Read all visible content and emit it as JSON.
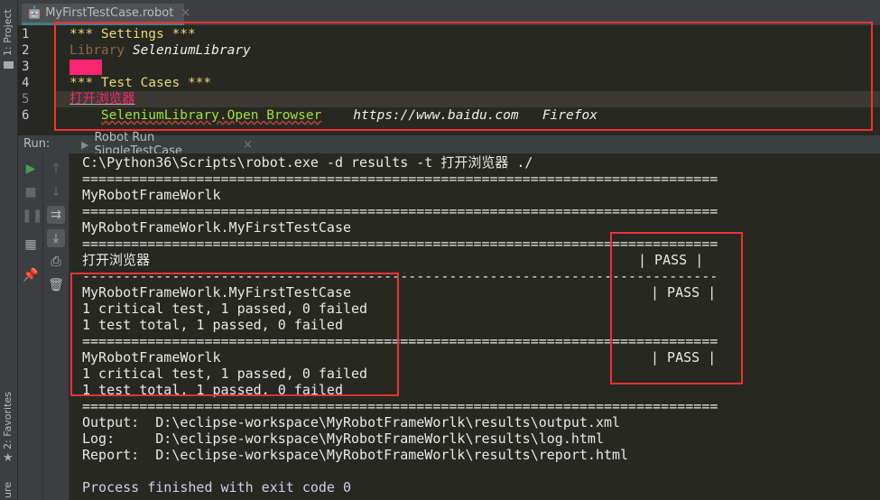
{
  "side": {
    "project": "1: Project",
    "favorites": "2: Favorites",
    "structure": "ure"
  },
  "editor_tab": {
    "label": "MyFirstTestCase.robot",
    "close": "×"
  },
  "editor": {
    "line_numbers": [
      "1",
      "2",
      "3",
      "4",
      "5",
      "6"
    ],
    "settings_header": "*** Settings ***",
    "library_kw": "Library",
    "library_name": "SeleniumLibrary",
    "testcases_header": "*** Test Cases ***",
    "test_name": "打开浏览器",
    "keyword": "SeleniumLibrary.Open Browser",
    "arg_url": "https://www.baidu.com",
    "arg_browser": "Firefox"
  },
  "run": {
    "label": "Run:",
    "tab": "Robot Run SingleTestCase",
    "close": "×"
  },
  "console": {
    "lines": [
      "C:\\Python36\\Scripts\\robot.exe -d results -t 打开浏览器 ./",
      "==============================================================================",
      "MyRobotFrameWorlk",
      "==============================================================================",
      "MyRobotFrameWorlk.MyFirstTestCase",
      "==============================================================================",
      "打开浏览器",
      "------------------------------------------------------------------------------",
      "MyRobotFrameWorlk.MyFirstTestCase",
      "1 critical test, 1 passed, 0 failed",
      "1 test total, 1 passed, 0 failed",
      "==============================================================================",
      "MyRobotFrameWorlk",
      "1 critical test, 1 passed, 0 failed",
      "1 test total, 1 passed, 0 failed",
      "==============================================================================",
      "Output:  D:\\eclipse-workspace\\MyRobotFrameWorlk\\results\\output.xml",
      "Log:     D:\\eclipse-workspace\\MyRobotFrameWorlk\\results\\log.html",
      "Report:  D:\\eclipse-workspace\\MyRobotFrameWorlk\\results\\report.html",
      "",
      "Process finished with exit code 0"
    ],
    "status_test": "| PASS |",
    "status_suite": "| PASS |",
    "status_root": "| PASS |"
  },
  "colors": {
    "highlight_box": "#f03232",
    "run_green": "#499c54",
    "keyword": "#a6e22e",
    "header": "#e6db74",
    "test_name": "#f92672"
  }
}
